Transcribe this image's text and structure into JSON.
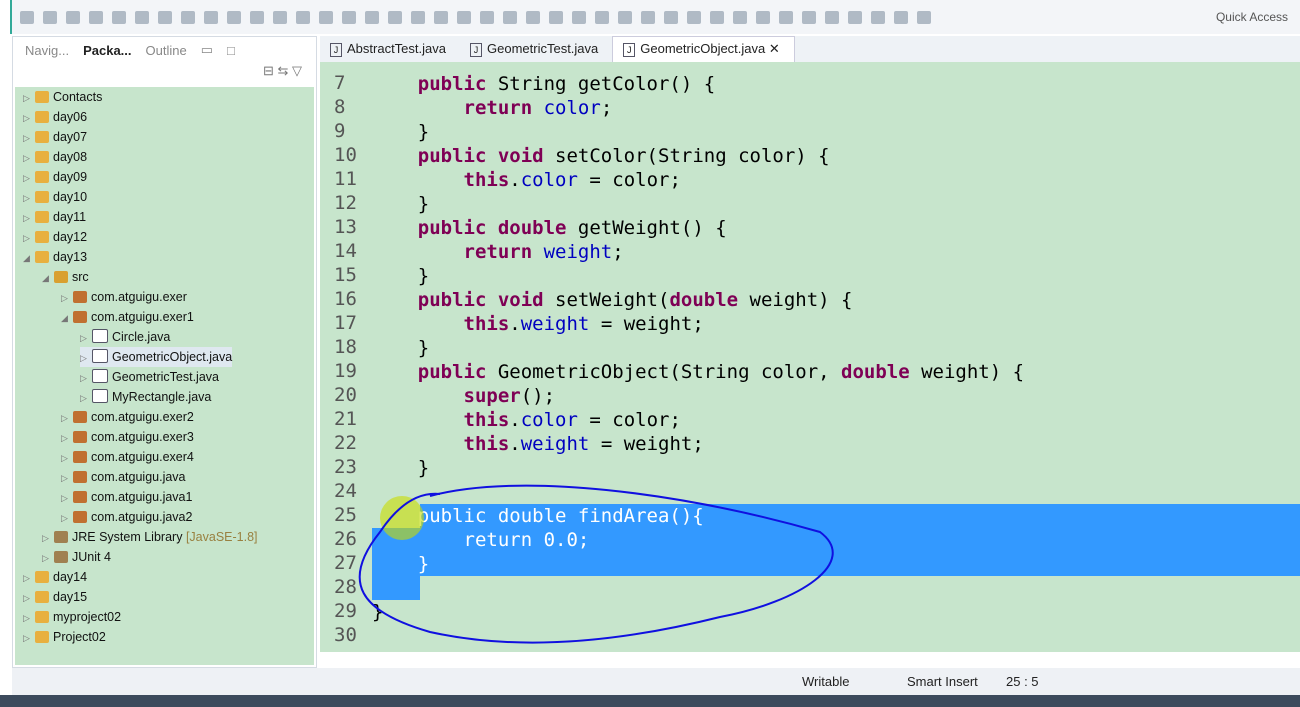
{
  "toolbar": {
    "quick_access": "Quick Access"
  },
  "left_panel": {
    "tabs": [
      {
        "label": "Navig..."
      },
      {
        "label": "Packa..."
      },
      {
        "label": "Outline"
      }
    ],
    "tree": [
      {
        "label": "Contacts",
        "depth": 0,
        "type": "project"
      },
      {
        "label": "day06",
        "depth": 0,
        "type": "project"
      },
      {
        "label": "day07",
        "depth": 0,
        "type": "project"
      },
      {
        "label": "day08",
        "depth": 0,
        "type": "project"
      },
      {
        "label": "day09",
        "depth": 0,
        "type": "project"
      },
      {
        "label": "day10",
        "depth": 0,
        "type": "project"
      },
      {
        "label": "day11",
        "depth": 0,
        "type": "project"
      },
      {
        "label": "day12",
        "depth": 0,
        "type": "project"
      },
      {
        "label": "day13",
        "depth": 0,
        "type": "project",
        "expanded": true
      },
      {
        "label": "src",
        "depth": 1,
        "type": "folder",
        "expanded": true
      },
      {
        "label": "com.atguigu.exer",
        "depth": 2,
        "type": "package"
      },
      {
        "label": "com.atguigu.exer1",
        "depth": 2,
        "type": "package",
        "expanded": true
      },
      {
        "label": "Circle.java",
        "depth": 3,
        "type": "java"
      },
      {
        "label": "GeometricObject.java",
        "depth": 3,
        "type": "java",
        "selected": true
      },
      {
        "label": "GeometricTest.java",
        "depth": 3,
        "type": "java"
      },
      {
        "label": "MyRectangle.java",
        "depth": 3,
        "type": "java"
      },
      {
        "label": "com.atguigu.exer2",
        "depth": 2,
        "type": "package"
      },
      {
        "label": "com.atguigu.exer3",
        "depth": 2,
        "type": "package"
      },
      {
        "label": "com.atguigu.exer4",
        "depth": 2,
        "type": "package"
      },
      {
        "label": "com.atguigu.java",
        "depth": 2,
        "type": "package"
      },
      {
        "label": "com.atguigu.java1",
        "depth": 2,
        "type": "package"
      },
      {
        "label": "com.atguigu.java2",
        "depth": 2,
        "type": "package"
      },
      {
        "label": "JRE System Library",
        "decoration": "[JavaSE-1.8]",
        "depth": 1,
        "type": "library"
      },
      {
        "label": "JUnit 4",
        "depth": 1,
        "type": "library"
      },
      {
        "label": "day14",
        "depth": 0,
        "type": "project"
      },
      {
        "label": "day15",
        "depth": 0,
        "type": "project"
      },
      {
        "label": "myproject02",
        "depth": 0,
        "type": "project"
      },
      {
        "label": "Project02",
        "depth": 0,
        "type": "project"
      }
    ]
  },
  "editor": {
    "tabs": [
      {
        "label": "AbstractTest.java"
      },
      {
        "label": "GeometricTest.java"
      },
      {
        "label": "GeometricObject.java",
        "active": true
      }
    ],
    "lines": [
      {
        "n": "7",
        "t": [
          [
            "    ",
            ""
          ],
          [
            "public",
            "kw"
          ],
          [
            " String getColor() {",
            ""
          ]
        ]
      },
      {
        "n": "8",
        "t": [
          [
            "        ",
            ""
          ],
          [
            "return",
            "kw"
          ],
          [
            " ",
            ""
          ],
          [
            "color",
            "fd"
          ],
          [
            ";",
            ""
          ]
        ]
      },
      {
        "n": "9",
        "t": [
          [
            "    }",
            ""
          ]
        ]
      },
      {
        "n": "10",
        "t": [
          [
            "    ",
            ""
          ],
          [
            "public void",
            "kw"
          ],
          [
            " setColor(String color) {",
            ""
          ]
        ]
      },
      {
        "n": "11",
        "t": [
          [
            "        ",
            ""
          ],
          [
            "this",
            "kw"
          ],
          [
            ".",
            ""
          ],
          [
            "color",
            "fd"
          ],
          [
            " = color;",
            ""
          ]
        ]
      },
      {
        "n": "12",
        "t": [
          [
            "    }",
            ""
          ]
        ]
      },
      {
        "n": "13",
        "t": [
          [
            "    ",
            ""
          ],
          [
            "public double",
            "kw"
          ],
          [
            " getWeight() {",
            ""
          ]
        ]
      },
      {
        "n": "14",
        "t": [
          [
            "        ",
            ""
          ],
          [
            "return",
            "kw"
          ],
          [
            " ",
            ""
          ],
          [
            "weight",
            "fd"
          ],
          [
            ";",
            ""
          ]
        ]
      },
      {
        "n": "15",
        "t": [
          [
            "    }",
            ""
          ]
        ]
      },
      {
        "n": "16",
        "t": [
          [
            "    ",
            ""
          ],
          [
            "public void",
            "kw"
          ],
          [
            " setWeight(",
            ""
          ],
          [
            "double",
            "kw"
          ],
          [
            " weight) {",
            ""
          ]
        ]
      },
      {
        "n": "17",
        "t": [
          [
            "        ",
            ""
          ],
          [
            "this",
            "kw"
          ],
          [
            ".",
            ""
          ],
          [
            "weight",
            "fd"
          ],
          [
            " = weight;",
            ""
          ]
        ]
      },
      {
        "n": "18",
        "t": [
          [
            "    }",
            ""
          ]
        ]
      },
      {
        "n": "19",
        "t": [
          [
            "    ",
            ""
          ],
          [
            "public",
            "kw"
          ],
          [
            " GeometricObject(String color, ",
            ""
          ],
          [
            "double",
            "kw"
          ],
          [
            " weight) {",
            ""
          ]
        ]
      },
      {
        "n": "20",
        "t": [
          [
            "        ",
            ""
          ],
          [
            "super",
            "kw"
          ],
          [
            "();",
            ""
          ]
        ]
      },
      {
        "n": "21",
        "t": [
          [
            "        ",
            ""
          ],
          [
            "this",
            "kw"
          ],
          [
            ".",
            ""
          ],
          [
            "color",
            "fd"
          ],
          [
            " = color;",
            ""
          ]
        ]
      },
      {
        "n": "22",
        "t": [
          [
            "        ",
            ""
          ],
          [
            "this",
            "kw"
          ],
          [
            ".",
            ""
          ],
          [
            "weight",
            "fd"
          ],
          [
            " = weight;",
            ""
          ]
        ]
      },
      {
        "n": "23",
        "t": [
          [
            "    }",
            ""
          ]
        ]
      },
      {
        "n": "24",
        "t": []
      },
      {
        "n": "25",
        "t": [
          [
            "    public double findArea(){",
            ""
          ]
        ],
        "selected": true
      },
      {
        "n": "26",
        "t": [
          [
            "        return 0.0;",
            ""
          ]
        ],
        "selected": true
      },
      {
        "n": "27",
        "t": [
          [
            "    }",
            ""
          ]
        ],
        "selected": true
      },
      {
        "n": "28",
        "t": []
      },
      {
        "n": "29",
        "t": [
          [
            "}",
            ""
          ]
        ]
      },
      {
        "n": "30",
        "t": []
      }
    ]
  },
  "status": {
    "mode": "Writable",
    "insert": "Smart Insert",
    "position": "25 : 5"
  },
  "colors": {
    "editor_bg": "#c7e5cc",
    "selection": "#3399ff",
    "keyword": "#7f0055",
    "field": "#0000c0",
    "annotation": "#0000ff"
  }
}
